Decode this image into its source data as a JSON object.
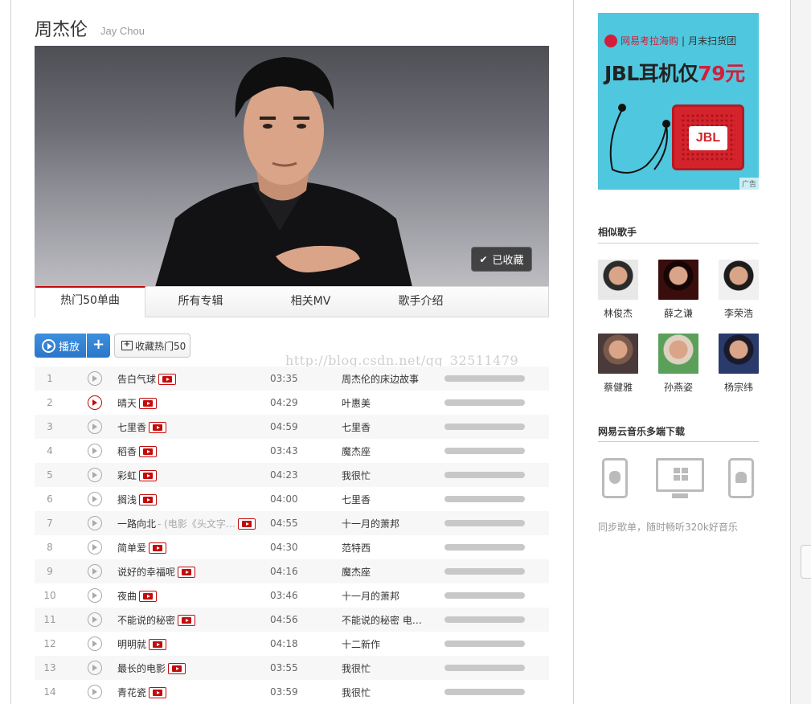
{
  "artist": {
    "name": "周杰伦",
    "alias": "Jay Chou",
    "collect_label": "已收藏"
  },
  "tabs": [
    {
      "label": "热门50单曲",
      "active": true
    },
    {
      "label": "所有专辑",
      "active": false
    },
    {
      "label": "相关MV",
      "active": false
    },
    {
      "label": "歌手介绍",
      "active": false
    }
  ],
  "actions": {
    "play_label": "播放",
    "add_label": "+",
    "collect_label": "收藏热门50"
  },
  "watermark": "http://blog.csdn.net/qq_32511479",
  "songs": [
    {
      "index": "1",
      "title": "告白气球",
      "subtitle": "",
      "duration": "03:35",
      "album": "周杰伦的床边故事",
      "playing": false
    },
    {
      "index": "2",
      "title": "晴天",
      "subtitle": "",
      "duration": "04:29",
      "album": "叶惠美",
      "playing": true
    },
    {
      "index": "3",
      "title": "七里香",
      "subtitle": "",
      "duration": "04:59",
      "album": "七里香",
      "playing": false
    },
    {
      "index": "4",
      "title": "稻香",
      "subtitle": "",
      "duration": "03:43",
      "album": "魔杰座",
      "playing": false
    },
    {
      "index": "5",
      "title": "彩虹",
      "subtitle": "",
      "duration": "04:23",
      "album": "我很忙",
      "playing": false
    },
    {
      "index": "6",
      "title": "搁浅",
      "subtitle": "",
      "duration": "04:00",
      "album": "七里香",
      "playing": false
    },
    {
      "index": "7",
      "title": "一路向北",
      "subtitle": " - (电影《头文字…",
      "duration": "04:55",
      "album": "十一月的萧邦",
      "playing": false
    },
    {
      "index": "8",
      "title": "简单爱",
      "subtitle": "",
      "duration": "04:30",
      "album": "范特西",
      "playing": false
    },
    {
      "index": "9",
      "title": "说好的幸福呢",
      "subtitle": "",
      "duration": "04:16",
      "album": "魔杰座",
      "playing": false
    },
    {
      "index": "10",
      "title": "夜曲",
      "subtitle": "",
      "duration": "03:46",
      "album": "十一月的萧邦",
      "playing": false
    },
    {
      "index": "11",
      "title": "不能说的秘密",
      "subtitle": "",
      "duration": "04:56",
      "album": "不能说的秘密 电…",
      "playing": false
    },
    {
      "index": "12",
      "title": "明明就",
      "subtitle": "",
      "duration": "04:18",
      "album": "十二新作",
      "playing": false
    },
    {
      "index": "13",
      "title": "最长的电影",
      "subtitle": "",
      "duration": "03:55",
      "album": "我很忙",
      "playing": false
    },
    {
      "index": "14",
      "title": "青花瓷",
      "subtitle": "",
      "duration": "03:59",
      "album": "我很忙",
      "playing": false
    }
  ],
  "ad": {
    "brand": "网易考拉海购",
    "separator": "|",
    "group": "月末扫货团",
    "headline": "JBL耳机仅",
    "price": "79元",
    "speaker_logo": "JBL",
    "tag": "广告"
  },
  "sidebar": {
    "similar_title": "相似歌手",
    "similar_artists": [
      "林俊杰",
      "薛之谦",
      "李荣浩",
      "蔡健雅",
      "孙燕姿",
      "杨宗纬"
    ],
    "download_title": "网易云音乐多端下载",
    "sync_text": "同步歌单，随时畅听320k好音乐"
  },
  "colors": {
    "accent_red": "#c20c0c",
    "play_blue": "#2b77c9",
    "ad_bg": "#4fc7de"
  }
}
